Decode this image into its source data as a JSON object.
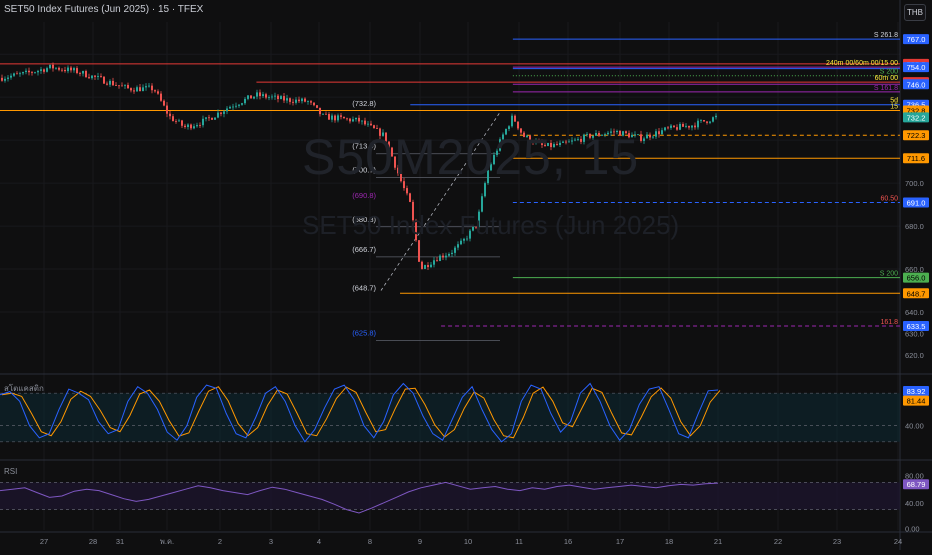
{
  "header": {
    "title": "SET50 Index Futures (Jun 2025) · 15 · TFEX",
    "currency": "THB"
  },
  "watermark": {
    "symbol": "S50M2025, 15",
    "description": "SET50 Index Futures (Jun 2025)"
  },
  "colors": {
    "up": "#26a69a",
    "down": "#ef5350",
    "red_level": "#e53935",
    "blue_level": "#2962ff",
    "orange_level": "#ff9800",
    "green_level": "#4caf50",
    "purple_level": "#9c27b0",
    "gold_label": "#ffeb3b",
    "stoch_k": "#2962ff",
    "stoch_d": "#ff9800",
    "rsi": "#7e57c2"
  },
  "price_axis": {
    "ticks": [
      "700.0",
      "680.0",
      "660.0",
      "640.0",
      "630.0",
      "620.0"
    ],
    "badges": [
      {
        "text": "767.0",
        "price": 767.0,
        "bg": "#2962ff",
        "fg": "#ffffff"
      },
      {
        "text": "755.5",
        "price": 755.5,
        "bg": "#e53935",
        "fg": "#ffffff"
      },
      {
        "text": "754.0",
        "price": 754.0,
        "bg": "#2962ff",
        "fg": "#ffffff"
      },
      {
        "text": "747.0",
        "price": 747.0,
        "bg": "#e53935",
        "fg": "#ffffff"
      },
      {
        "text": "746.0",
        "price": 746.0,
        "bg": "#2962ff",
        "fg": "#ffffff"
      },
      {
        "text": "736.5",
        "price": 736.5,
        "bg": "#2962ff",
        "fg": "#ffffff"
      },
      {
        "text": "732.8",
        "price": 733.8,
        "bg": "#ff9800",
        "fg": "#000000"
      },
      {
        "text": "732.2",
        "price": 730.6,
        "bg": "#26a69a",
        "fg": "#ffffff"
      },
      {
        "text": "722.3",
        "price": 722.3,
        "bg": "#ff9800",
        "fg": "#000000"
      },
      {
        "text": "711.6",
        "price": 711.6,
        "bg": "#ff9800",
        "fg": "#000000"
      },
      {
        "text": "691.0",
        "price": 691.0,
        "bg": "#2962ff",
        "fg": "#ffffff"
      },
      {
        "text": "656.0",
        "price": 656.0,
        "bg": "#4caf50",
        "fg": "#000000"
      },
      {
        "text": "648.7",
        "price": 648.7,
        "bg": "#ff9800",
        "fg": "#000000"
      },
      {
        "text": "633.5",
        "price": 633.5,
        "bg": "#2962ff",
        "fg": "#ffffff"
      }
    ]
  },
  "levels": [
    {
      "price": 767.0,
      "from_day": 10.0,
      "color": "#2962ff",
      "style": "solid",
      "label": "S 261.8",
      "label_color": "#d1d4dc"
    },
    {
      "price": 755.5,
      "from_day": 0.0,
      "color": "#e53935",
      "style": "solid",
      "label": "",
      "label_color": ""
    },
    {
      "price": 754.0,
      "from_day": 10.0,
      "color": "#9c27b0",
      "style": "solid",
      "label": "240m 00/60m 00/15 00",
      "label_color": "#ffeb3b"
    },
    {
      "price": 753.3,
      "from_day": 10.0,
      "color": "#2962ff",
      "style": "solid",
      "label": "",
      "label_color": ""
    },
    {
      "price": 750.0,
      "from_day": 10.0,
      "color": "#4caf50",
      "style": "dotted",
      "label": "S 200",
      "label_color": "#4caf50"
    },
    {
      "price": 747.0,
      "from_day": 5.0,
      "color": "#e53935",
      "style": "solid",
      "label": "60m 00",
      "label_color": "#ffeb3b"
    },
    {
      "price": 746.0,
      "from_day": 10.0,
      "color": "#9c27b0",
      "style": "solid",
      "label": "",
      "label_color": ""
    },
    {
      "price": 742.5,
      "from_day": 10.0,
      "color": "#9c27b0",
      "style": "solid",
      "label": "S 161.8",
      "label_color": "#9c27b0"
    },
    {
      "price": 736.5,
      "from_day": 8.0,
      "color": "#2962ff",
      "style": "solid",
      "label": "5d",
      "label_color": "#ffeb3b"
    },
    {
      "price": 733.8,
      "from_day": 0.0,
      "color": "#ff9800",
      "style": "solid",
      "label": "15",
      "label_color": "#ffeb3b"
    },
    {
      "price": 722.3,
      "from_day": 10.0,
      "color": "#ff9800",
      "style": "dashed",
      "label": "",
      "label_color": ""
    },
    {
      "price": 711.6,
      "from_day": 10.0,
      "color": "#ff9800",
      "style": "solid",
      "label": "",
      "label_color": ""
    },
    {
      "price": 691.0,
      "from_day": 10.0,
      "color": "#2962ff",
      "style": "dashed",
      "label": "60.50",
      "label_color": "#ef5350"
    },
    {
      "price": 656.0,
      "from_day": 10.0,
      "color": "#4caf50",
      "style": "solid",
      "label": "S 200",
      "label_color": "#4caf50"
    },
    {
      "price": 648.7,
      "from_day": 7.8,
      "color": "#ff9800",
      "style": "solid",
      "label": "",
      "label_color": ""
    },
    {
      "price": 633.5,
      "from_day": 8.6,
      "color": "#9c27b0",
      "style": "dashed",
      "label": "161.8",
      "label_color": "#ef5350"
    }
  ],
  "fib_labels": [
    {
      "text": "(732.8)",
      "price": 736.0,
      "color": "#d1d4dc"
    },
    {
      "text": "(713.0)",
      "price": 716.0,
      "color": "#d1d4dc"
    },
    {
      "text": "(700.7)",
      "price": 705.0,
      "color": "#d1d4dc"
    },
    {
      "text": "(690.8)",
      "price": 693.0,
      "color": "#9c27b0"
    },
    {
      "text": "(680.8)",
      "price": 682.0,
      "color": "#d1d4dc"
    },
    {
      "text": "(666.7)",
      "price": 668.0,
      "color": "#d1d4dc"
    },
    {
      "text": "(648.7)",
      "price": 650.0,
      "color": "#d1d4dc"
    },
    {
      "text": "(625.8)",
      "price": 629.0,
      "color": "#2962ff"
    }
  ],
  "chart_data": {
    "type": "candlestick",
    "title": "SET50 Index Futures (Jun 2025) · 15 · TFEX",
    "ylim": [
      613,
      775
    ],
    "x_ticks": [
      "27",
      "28",
      "31",
      "พ.ค.",
      "2",
      "3",
      "4",
      "8",
      "9",
      "10",
      "11",
      "16",
      "17",
      "18",
      "21",
      "22",
      "23",
      "24"
    ],
    "price_path": [
      {
        "day": 0.0,
        "price": 749
      },
      {
        "day": 0.5,
        "price": 751
      },
      {
        "day": 1.0,
        "price": 754
      },
      {
        "day": 1.5,
        "price": 752
      },
      {
        "day": 2.0,
        "price": 748
      },
      {
        "day": 2.5,
        "price": 744
      },
      {
        "day": 3.0,
        "price": 744
      },
      {
        "day": 3.3,
        "price": 731
      },
      {
        "day": 3.6,
        "price": 726
      },
      {
        "day": 4.0,
        "price": 729
      },
      {
        "day": 4.5,
        "price": 736
      },
      {
        "day": 5.0,
        "price": 741
      },
      {
        "day": 5.5,
        "price": 739
      },
      {
        "day": 6.0,
        "price": 738
      },
      {
        "day": 6.3,
        "price": 731
      },
      {
        "day": 7.0,
        "price": 729
      },
      {
        "day": 7.5,
        "price": 722
      },
      {
        "day": 7.8,
        "price": 702
      },
      {
        "day": 8.0,
        "price": 690
      },
      {
        "day": 8.2,
        "price": 660
      },
      {
        "day": 8.5,
        "price": 665
      },
      {
        "day": 8.8,
        "price": 668
      },
      {
        "day": 9.0,
        "price": 672
      },
      {
        "day": 9.3,
        "price": 681
      },
      {
        "day": 9.5,
        "price": 705
      },
      {
        "day": 9.8,
        "price": 722
      },
      {
        "day": 10.0,
        "price": 731
      },
      {
        "day": 10.2,
        "price": 722
      },
      {
        "day": 10.6,
        "price": 717
      },
      {
        "day": 11.0,
        "price": 718
      },
      {
        "day": 11.5,
        "price": 722
      },
      {
        "day": 12.0,
        "price": 724
      },
      {
        "day": 12.5,
        "price": 721
      },
      {
        "day": 13.0,
        "price": 725
      },
      {
        "day": 13.5,
        "price": 727
      },
      {
        "day": 14.0,
        "price": 731
      }
    ],
    "series": [
      {
        "name": "สโตแคสติก",
        "values_last": [
          83.92,
          81.44
        ],
        "ylim": [
          0,
          100
        ],
        "levels": [
          80,
          40,
          20
        ]
      },
      {
        "name": "RSI",
        "value_last": 68.79,
        "ylim": [
          0,
          100
        ],
        "levels": [
          70,
          30
        ]
      }
    ]
  },
  "stoch": {
    "label": "สโตแคสติก",
    "k_value": "83.92",
    "d_value": "81.44",
    "ticks": [
      "40.00"
    ],
    "path": [
      78,
      82,
      70,
      40,
      25,
      30,
      60,
      85,
      80,
      72,
      45,
      30,
      35,
      70,
      88,
      80,
      60,
      32,
      22,
      40,
      75,
      90,
      86,
      55,
      30,
      25,
      50,
      80,
      88,
      70,
      40,
      20,
      35,
      62,
      85,
      90,
      72,
      40,
      25,
      45,
      78,
      92,
      80,
      52,
      30,
      22,
      48,
      75,
      88,
      60,
      35,
      20,
      30,
      70,
      90,
      85,
      55,
      32,
      45,
      80,
      92,
      70,
      40,
      22,
      35,
      66,
      85,
      88,
      60,
      30,
      25,
      55,
      83,
      84
    ]
  },
  "rsi": {
    "label": "RSI",
    "value": "68.79",
    "ticks": [
      "80.00",
      "40.00",
      "0.00"
    ],
    "path": [
      58,
      60,
      62,
      55,
      48,
      50,
      57,
      60,
      58,
      52,
      46,
      42,
      45,
      50,
      55,
      60,
      65,
      62,
      58,
      55,
      52,
      58,
      63,
      60,
      55,
      50,
      45,
      38,
      30,
      25,
      32,
      40,
      48,
      56,
      62,
      66,
      70,
      65,
      60,
      62,
      64,
      60,
      58,
      62,
      60,
      64,
      66,
      63,
      60,
      62,
      64,
      66,
      64,
      62,
      65,
      67,
      66,
      68,
      69
    ]
  }
}
